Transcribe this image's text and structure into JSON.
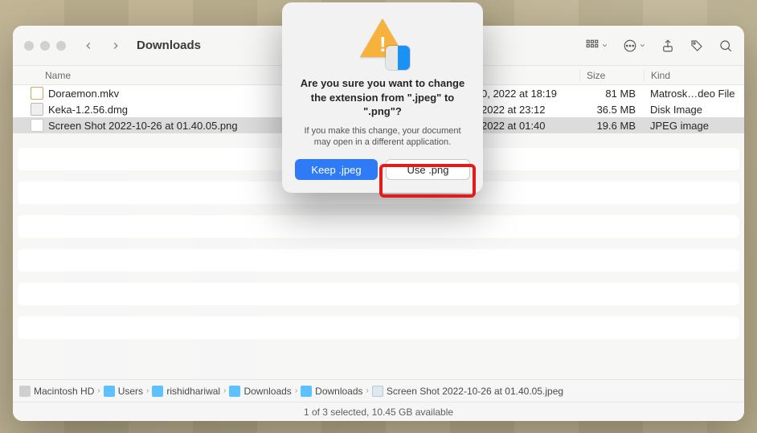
{
  "window": {
    "title": "Downloads"
  },
  "columns": {
    "name": "Name",
    "date": "",
    "size": "Size",
    "kind": "Kind"
  },
  "files": [
    {
      "name": "Doraemon.mkv",
      "date": "0, 2022 at 18:19",
      "size": "81 MB",
      "kind": "Matrosk…deo File",
      "ico": "ico-mkv",
      "sel": false
    },
    {
      "name": "Keka-1.2.56.dmg",
      "date": "2022 at 23:12",
      "size": "36.5 MB",
      "kind": "Disk Image",
      "ico": "ico-dmg",
      "sel": false
    },
    {
      "name": "Screen Shot 2022-10-26 at 01.40.05.png",
      "date": "2022 at 01:40",
      "size": "19.6 MB",
      "kind": "JPEG image",
      "ico": "ico-png",
      "sel": true
    }
  ],
  "path": [
    {
      "label": "Macintosh HD",
      "ico": "pf-disk"
    },
    {
      "label": "Users",
      "ico": "pf-fold"
    },
    {
      "label": "rishidhariwal",
      "ico": "pf-fold"
    },
    {
      "label": "Downloads",
      "ico": "pf-fold"
    },
    {
      "label": "Downloads",
      "ico": "pf-fold"
    },
    {
      "label": "Screen Shot 2022-10-26 at 01.40.05.jpeg",
      "ico": "pf-file"
    }
  ],
  "status": "1 of 3 selected, 10.45 GB available",
  "modal": {
    "title": "Are you sure you want to change the extension from \".jpeg\" to \".png\"?",
    "subtitle": "If you make this change, your document may open in a different application.",
    "keep": "Keep .jpeg",
    "use": "Use .png"
  }
}
